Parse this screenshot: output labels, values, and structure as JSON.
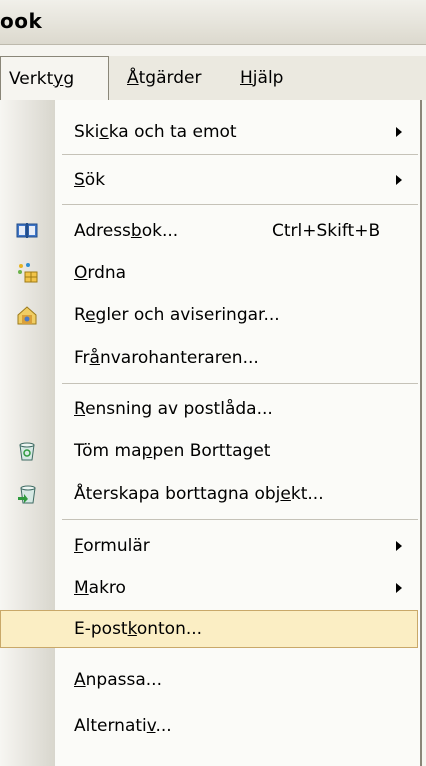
{
  "window": {
    "title_fragment": "ook"
  },
  "menubar": {
    "items": [
      {
        "pre": "Verkt",
        "mnemonic": "y",
        "post": "g"
      },
      {
        "pre": "",
        "mnemonic": "Å",
        "post": "tgärder"
      },
      {
        "pre": "",
        "mnemonic": "H",
        "post": "jälp"
      }
    ]
  },
  "menu": {
    "items": [
      {
        "pre": "Ski",
        "mnemonic": "c",
        "post": "ka och ta emot",
        "submenu": true
      },
      {
        "pre": "",
        "mnemonic": "S",
        "post": "ök",
        "submenu": true
      },
      {
        "pre": "Adress",
        "mnemonic": "b",
        "post": "ok...",
        "shortcut": "Ctrl+Skift+B",
        "icon": "address-book-icon"
      },
      {
        "pre": "",
        "mnemonic": "O",
        "post": "rdna",
        "icon": "organize-icon"
      },
      {
        "pre": "R",
        "mnemonic": "e",
        "post": "gler och aviseringar...",
        "icon": "rules-alerts-icon"
      },
      {
        "pre": "Fr",
        "mnemonic": "å",
        "post": "nvarohanteraren..."
      },
      {
        "pre": "",
        "mnemonic": "R",
        "post": "ensning av postlåda..."
      },
      {
        "pre": "Töm ma",
        "mnemonic": "p",
        "post": "pen Borttaget",
        "icon": "empty-trash-icon"
      },
      {
        "pre": "Återskapa borttagna obj",
        "mnemonic": "e",
        "post": "kt...",
        "icon": "recover-deleted-icon"
      },
      {
        "pre": "",
        "mnemonic": "F",
        "post": "ormulär",
        "submenu": true
      },
      {
        "pre": "",
        "mnemonic": "M",
        "post": "akro",
        "submenu": true
      },
      {
        "pre": "E-post",
        "mnemonic": "k",
        "post": "onton...",
        "highlighted": true
      },
      {
        "pre": "",
        "mnemonic": "A",
        "post": "npassa..."
      },
      {
        "pre": "Alternati",
        "mnemonic": "v",
        "post": "..."
      }
    ]
  }
}
